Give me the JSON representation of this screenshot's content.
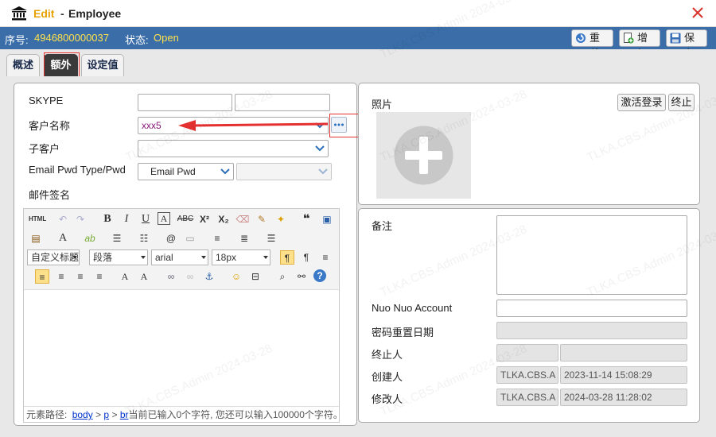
{
  "window": {
    "title_edit": "Edit",
    "title_dash": "-",
    "title_entity": "Employee"
  },
  "status": {
    "number_label": "序号:",
    "number_value": "4946800000037",
    "state_label": "状态:",
    "state_value": "Open"
  },
  "toolbar": {
    "reload_label": "重载",
    "add_label": "增加",
    "save_label": "保存"
  },
  "tabs": [
    {
      "label": "概述"
    },
    {
      "label": "额外"
    },
    {
      "label": "设定值"
    }
  ],
  "form": {
    "skype_label": "SKYPE",
    "customer_label": "客户名称",
    "customer_value": "xxx5",
    "subcustomer_label": "子客户",
    "email_pwd_label": "Email Pwd Type/Pwd",
    "email_pwd_type_value": "Email Pwd",
    "signature_label": "邮件签名"
  },
  "editor": {
    "html_button": "HTML",
    "custom_heading": "自定义标题",
    "paragraph": "段落",
    "font": "arial",
    "font_size": "18px",
    "path_label": "元素路径:",
    "path_body": "body",
    "path_sep": ">",
    "path_p": "p",
    "path_br": "br",
    "count_text": "当前已输入0个字符, 您还可以输入100000个字符。"
  },
  "photo": {
    "label": "照片",
    "activate_label": "激活登录",
    "terminate_label": "终止"
  },
  "details": {
    "remark_label": "备注",
    "nuo_label": "Nuo Nuo Account",
    "pwd_reset_label": "密码重置日期",
    "terminated_by_label": "终止人",
    "creator_label": "创建人",
    "creator_user": "TLKA.CBS.A",
    "creator_time": "2023-11-14 15:08:29",
    "modifier_label": "修改人",
    "modifier_user": "TLKA.CBS.A",
    "modifier_time": "2024-03-28 11:28:02"
  },
  "watermark": "TLKA.CBS.Admin 2024-03-28",
  "colors": {
    "status_bar": "#3b6ea8",
    "status_value": "#ffe14a",
    "title_edit": "#e8a100",
    "close_icon": "#d9342b",
    "customer_value_text": "#8a1a7a",
    "annotation_red": "#e53030"
  }
}
